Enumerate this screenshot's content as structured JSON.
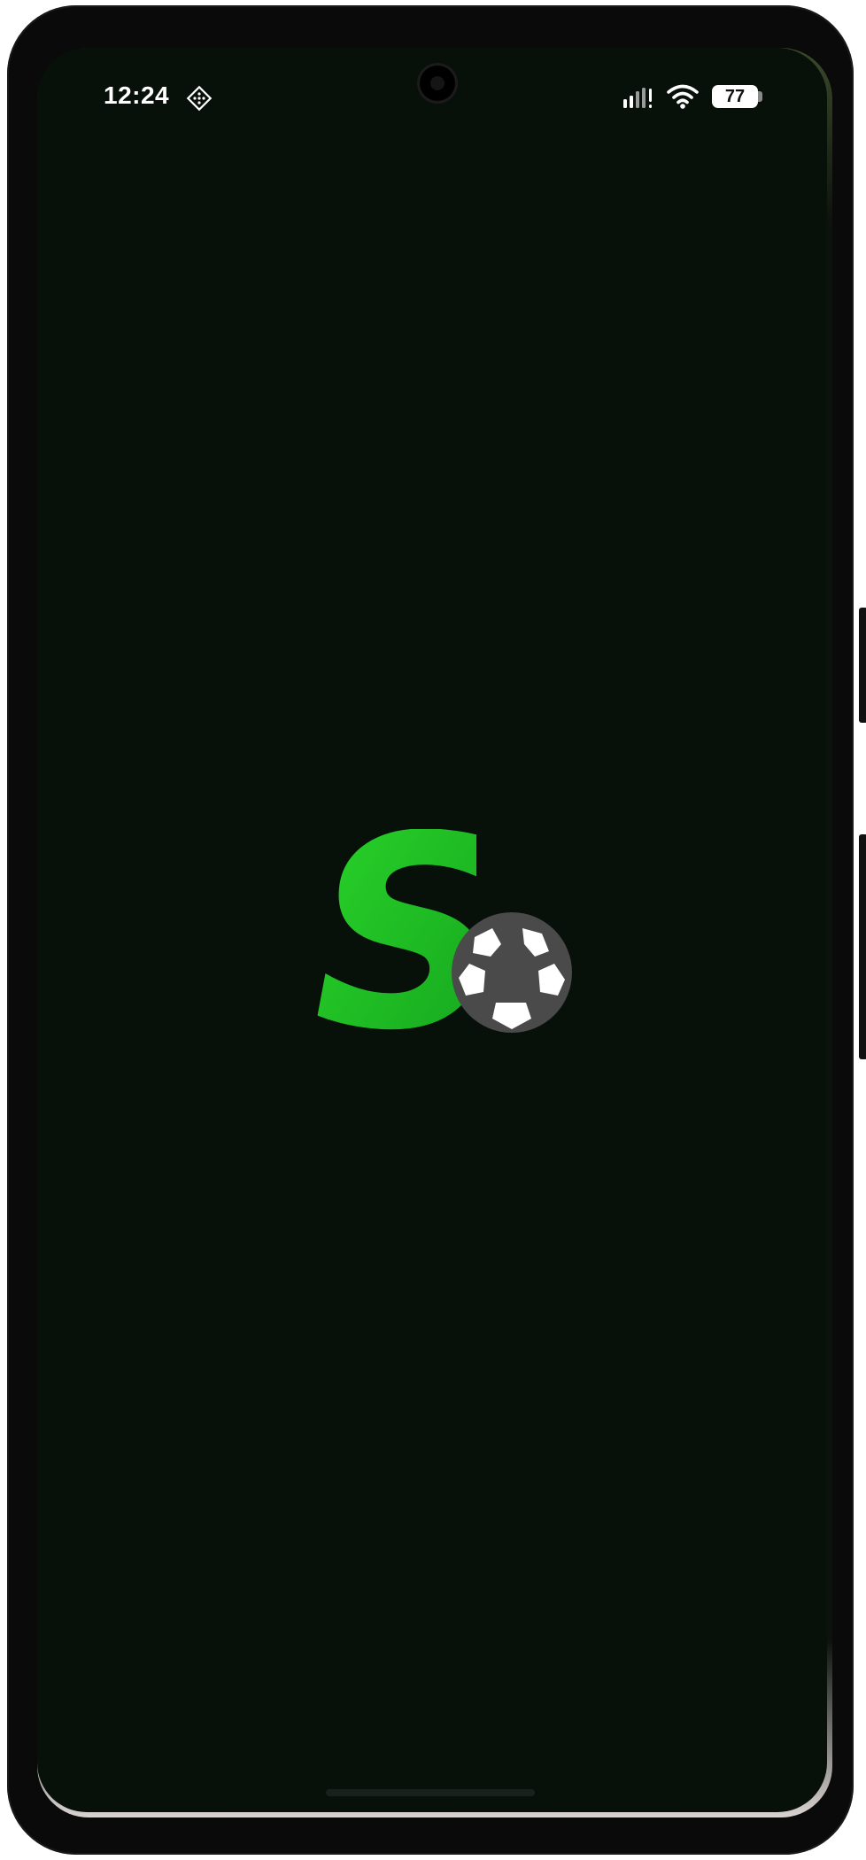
{
  "status_bar": {
    "time": "12:24",
    "battery_level": "77",
    "icons": [
      "diamond-grid-icon",
      "signal-icon",
      "wifi-icon",
      "battery-icon"
    ]
  },
  "splash": {
    "logo_letter": "S",
    "logo_icon": "soccer-ball-icon"
  },
  "colors": {
    "background": "#08100a",
    "brand_green": "#22c422",
    "ball_dark": "#4a4a4a",
    "ball_light": "#ffffff"
  }
}
